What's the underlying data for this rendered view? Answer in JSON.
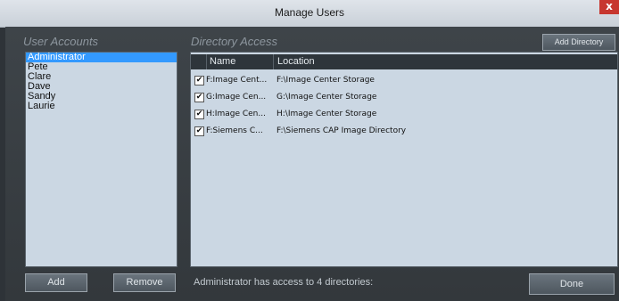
{
  "window": {
    "title": "Manage Users",
    "close_glyph": "x"
  },
  "users_section": {
    "title": "User Accounts",
    "items": [
      {
        "label": "Administrator",
        "selected": true
      },
      {
        "label": "Pete"
      },
      {
        "label": "Clare"
      },
      {
        "label": "Dave"
      },
      {
        "label": "Sandy"
      },
      {
        "label": "Laurie"
      }
    ],
    "add_label": "Add",
    "remove_label": "Remove"
  },
  "directory_section": {
    "title": "Directory Access",
    "add_directory_label": "Add Directory",
    "columns": [
      "Name",
      "Location"
    ],
    "rows": [
      {
        "checked": true,
        "name": "F:Image Cent...",
        "location": "F:\\Image Center Storage"
      },
      {
        "checked": true,
        "name": "G:Image Cen...",
        "location": "G:\\Image Center Storage"
      },
      {
        "checked": true,
        "name": "H:Image Cen...",
        "location": "H:\\Image Center Storage"
      },
      {
        "checked": true,
        "name": "F:Siemens C...",
        "location": "F:\\Siemens CAP Image Directory"
      }
    ],
    "check_glyph": "✔"
  },
  "footer": {
    "status": "Administrator has access to 4 directories:",
    "done_label": "Done"
  },
  "colors": {
    "title_bar": "#d3d9df",
    "panel_background": "#cbd7e3",
    "selection": "#3399ff",
    "close_button": "#c7372f",
    "window_body": "#3a4045"
  }
}
